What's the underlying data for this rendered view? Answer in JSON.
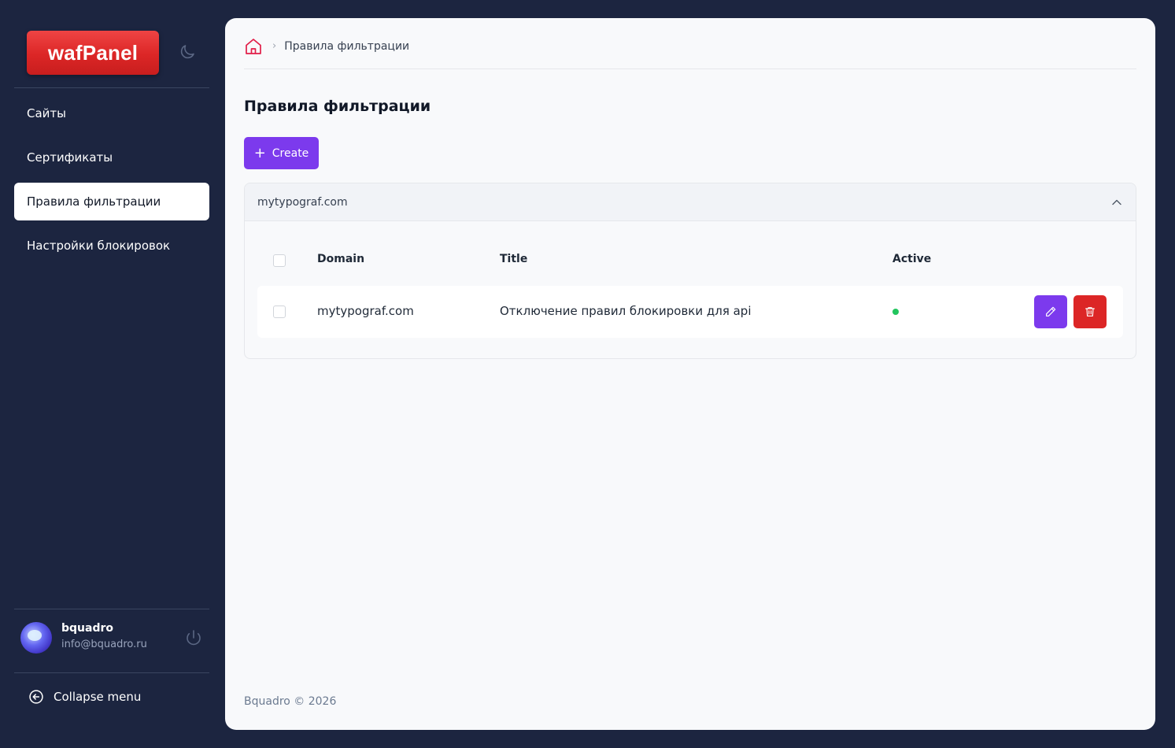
{
  "app": {
    "logo_text": "wafPanel"
  },
  "sidebar": {
    "items": [
      {
        "label": "Сайты"
      },
      {
        "label": "Сертификаты"
      },
      {
        "label": "Правила фильтрации"
      },
      {
        "label": "Настройки блокировок"
      }
    ],
    "active_index": 2,
    "user": {
      "name": "bquadro",
      "email": "info@bquadro.ru"
    },
    "collapse_label": "Collapse menu"
  },
  "breadcrumb": {
    "current": "Правила фильтрации"
  },
  "page": {
    "title": "Правила фильтрации",
    "create_label": "Create"
  },
  "group": {
    "header": "mytypograf.com",
    "columns": {
      "domain": "Domain",
      "title": "Title",
      "active": "Active"
    },
    "rows": [
      {
        "domain": "mytypograf.com",
        "title": "Отключение правил блокировки для api",
        "active": true
      }
    ]
  },
  "footer": {
    "text": "Bquadro © 2026"
  },
  "colors": {
    "accent": "#7c3aed",
    "danger": "#dc2626",
    "active_dot": "#22c55e",
    "sidebar_bg": "#1c2540"
  }
}
